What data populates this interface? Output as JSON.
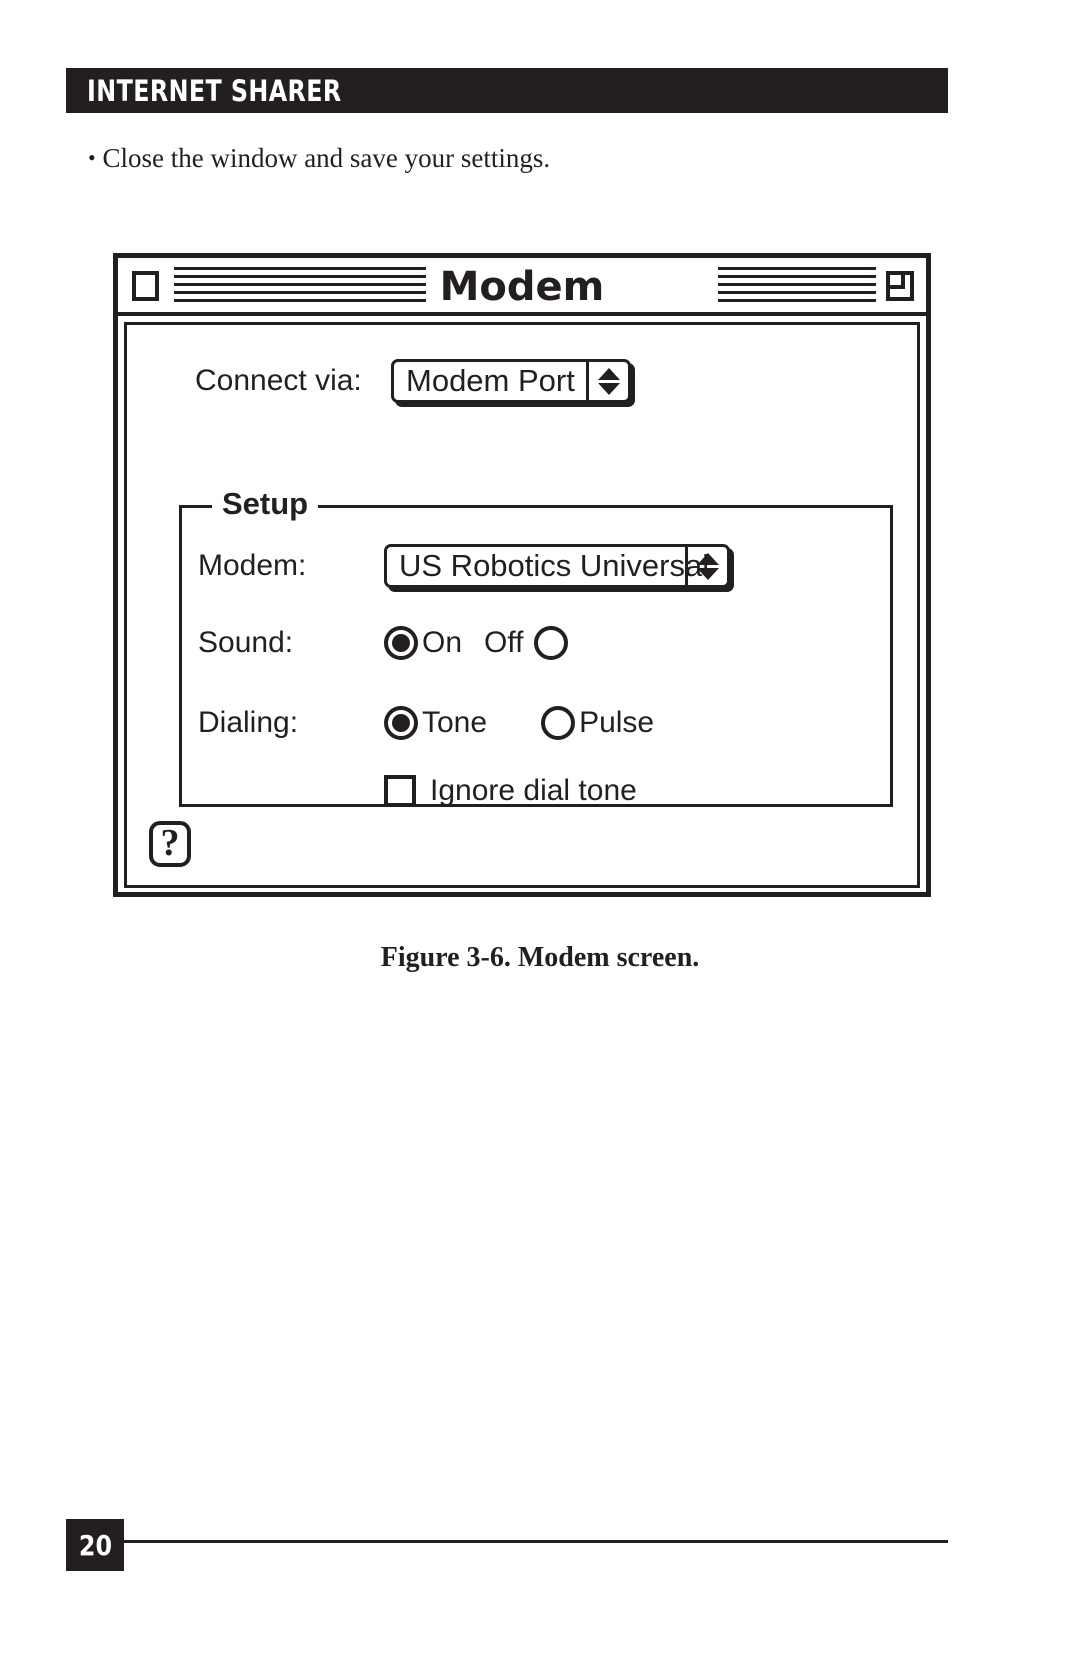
{
  "page": {
    "running_header": "INTERNET SHARER",
    "body_bullet": "Close the window and save your settings.",
    "bullet_glyph": "•",
    "figure_caption": "Figure 3-6. Modem screen.",
    "page_number": "20",
    "ink_color": "#231f20",
    "paper_color": "#ffffff"
  },
  "dialog": {
    "title": "Modem",
    "close_box_icon": "close-box-icon",
    "zoom_box_icon": "zoom-box-icon",
    "connect": {
      "label": "Connect via:",
      "value": "Modem Port",
      "arrows_icon": "up-down-arrows-icon"
    },
    "setup_group": {
      "legend": "Setup",
      "modem": {
        "label": "Modem:",
        "value": "US Robotics Universal",
        "arrows_icon": "up-down-arrows-icon"
      },
      "sound": {
        "label": "Sound:",
        "options": [
          {
            "label": "On",
            "selected": true,
            "radio_side": "before"
          },
          {
            "label": "Off",
            "selected": false,
            "radio_side": "after"
          }
        ]
      },
      "dialing": {
        "label": "Dialing:",
        "options": [
          {
            "label": "Tone",
            "selected": true,
            "radio_side": "before"
          },
          {
            "label": "Pulse",
            "selected": false,
            "radio_side": "before"
          }
        ]
      },
      "ignore_dial_tone": {
        "label": "Ignore dial tone",
        "checked": false
      }
    },
    "help_button": {
      "label": "?",
      "icon": "question-mark-icon"
    }
  }
}
